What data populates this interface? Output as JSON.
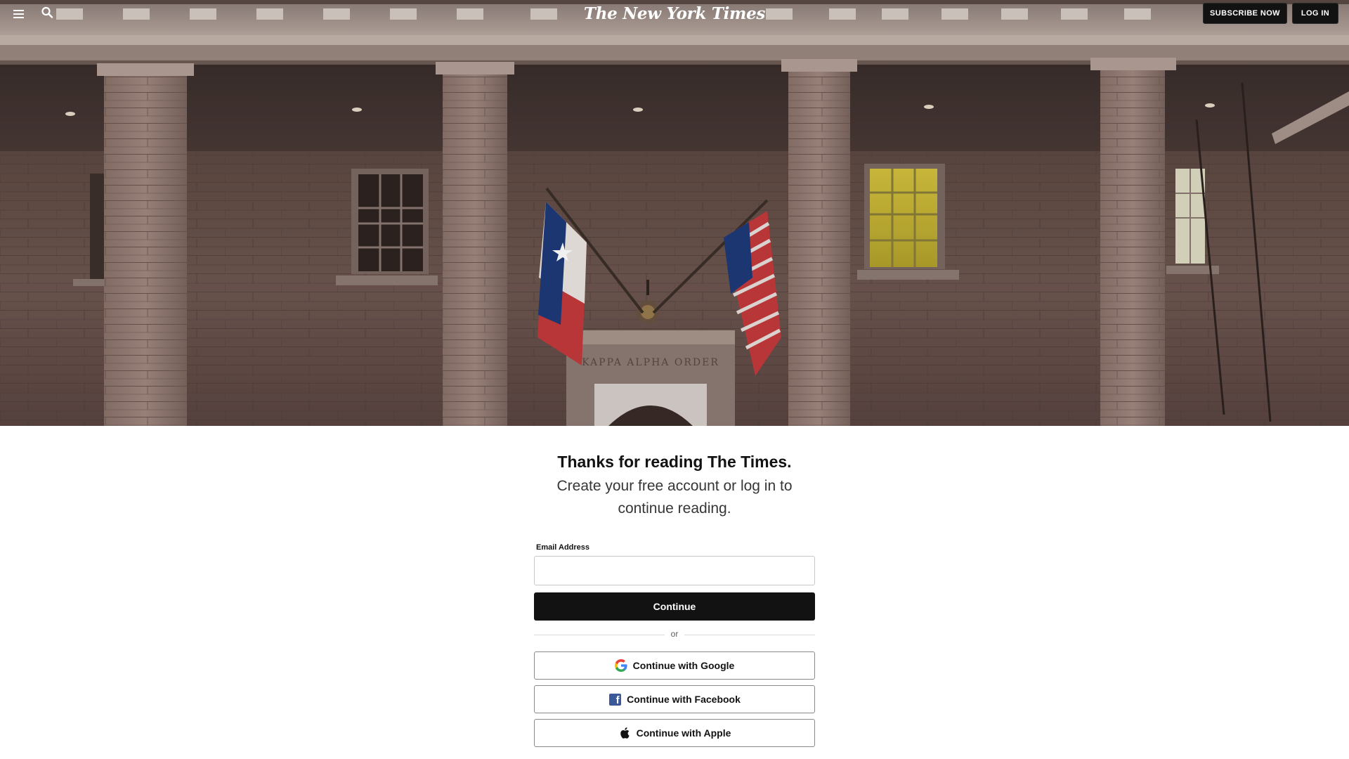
{
  "header": {
    "logo": "The New York Times",
    "menu_icon": "hamburger-menu-icon",
    "search_icon": "search-icon",
    "subscribe_label": "SUBSCRIBE NOW",
    "login_label": "LOG IN"
  },
  "hero": {
    "engraving": "KAPPA ALPHA ORDER"
  },
  "main": {
    "heading": "Thanks for reading The Times.",
    "subheading": "Create your free account or log in to continue reading.",
    "email_label": "Email Address",
    "email_value": "",
    "continue_label": "Continue",
    "divider_text": "or",
    "google_label": "Continue with Google",
    "facebook_label": "Continue with Facebook",
    "apple_label": "Continue with Apple"
  },
  "colors": {
    "button_dark": "#121212",
    "facebook_blue": "#3b5998",
    "text": "#121212"
  }
}
